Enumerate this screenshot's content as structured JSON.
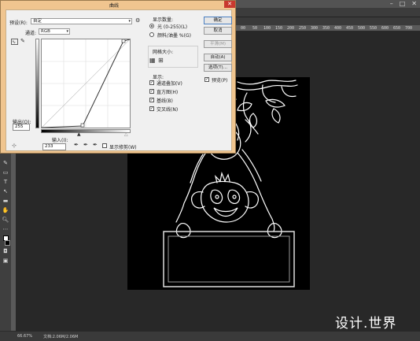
{
  "photoshop": {
    "window_controls": [
      "–",
      "□",
      "✕"
    ],
    "ruler_ticks": [
      "00",
      "50",
      "100",
      "150",
      "200",
      "250",
      "300",
      "350",
      "400",
      "450",
      "500",
      "550",
      "600",
      "650",
      "700"
    ],
    "status_zoom": "66.67%",
    "status_doc": "文档:2.06M/2.06M",
    "watermark": "设计.世界"
  },
  "dialog": {
    "title": "曲线",
    "close": "✕",
    "preset_label": "预设(R):",
    "preset_value": "自定",
    "channel_label": "通道:",
    "channel_value": "RGB",
    "output_label": "输出(O):",
    "output_value": "255",
    "input_label": "输入(I):",
    "input_value": "233",
    "show_clipping_label": "显示修剪(W)",
    "display_amount_title": "显示数量:",
    "light_option": "光 (0-255)(L)",
    "pigment_option": "颜料/油墨 %(G)",
    "grid_size_title": "网格大小:",
    "show_title": "显示:",
    "show_options": [
      "通道叠加(V)",
      "直方图(H)",
      "基线(B)",
      "交叉线(N)"
    ],
    "buttons": {
      "ok": "确定",
      "cancel": "取消",
      "smooth": "平滑(M)",
      "auto": "自动(A)",
      "options": "选项(T)...",
      "preview": "预览(P)"
    }
  }
}
